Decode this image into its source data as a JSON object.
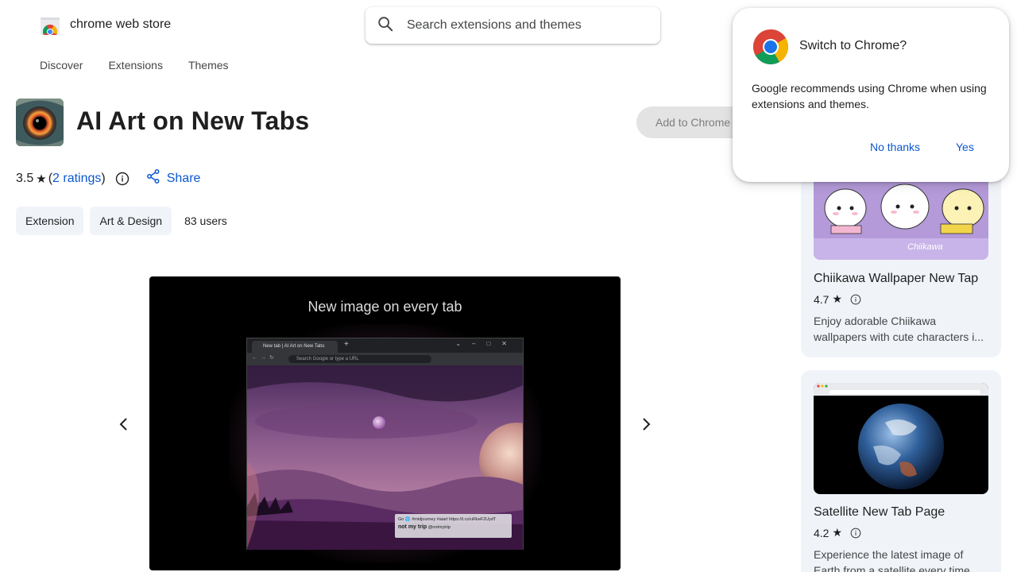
{
  "header": {
    "store_name": "chrome web store",
    "search_placeholder": "Search extensions and themes",
    "nav": [
      "Discover",
      "Extensions",
      "Themes"
    ]
  },
  "extension": {
    "name": "AI Art on New Tabs",
    "add_button": "Add to Chrome",
    "rating_value": "3.5",
    "rating_count_text": "2 ratings",
    "share_label": "Share",
    "chips": [
      "Extension",
      "Art & Design"
    ],
    "users": "83 users"
  },
  "carousel": {
    "caption": "New image on every tab",
    "browser_tab": "New tab | AI Art on New Tabs",
    "browser_url": "Search Google or type a URL",
    "tweet_line1": "Gn 🌐 #midjourney #aiart https://t.co/uRkeF2UydT",
    "tweet_name": "not my trip",
    "tweet_handle": "@notmytrip"
  },
  "sidebar": {
    "cards": [
      {
        "title": "Chiikawa Wallpaper New Tap",
        "rating": "4.7",
        "description": "Enjoy adorable Chiikawa wallpapers with cute characters i..."
      },
      {
        "title": "Satellite New Tab Page",
        "rating": "4.2",
        "description": "Experience the latest image of Earth from a satellite every time"
      }
    ]
  },
  "popup": {
    "title": "Switch to Chrome?",
    "body": "Google recommends using Chrome when using extensions and themes.",
    "no_label": "No thanks",
    "yes_label": "Yes"
  },
  "colors": {
    "link_blue": "#0b57d0",
    "chip_bg": "#f0f4f9",
    "button_disabled_bg": "#e3e3e3"
  }
}
